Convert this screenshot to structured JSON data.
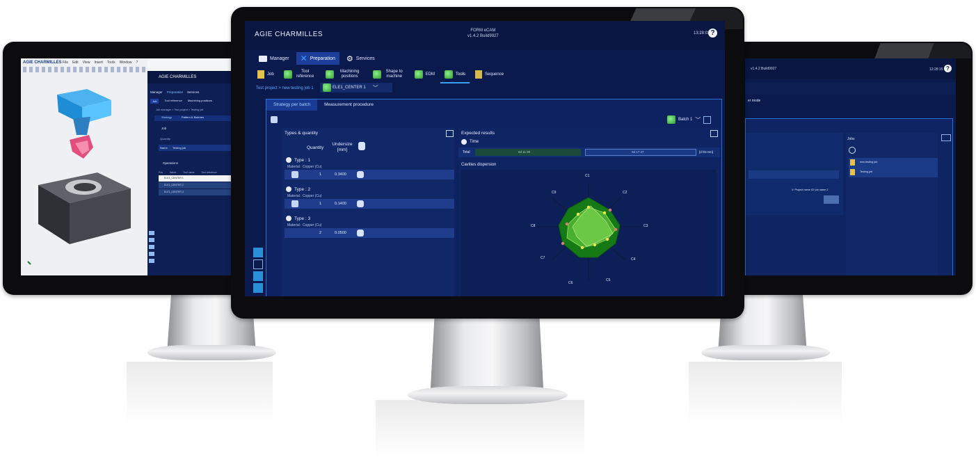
{
  "center": {
    "brand": "AGIE CHARMILLES",
    "app_name": "FORM eCAM",
    "app_version": "v1.4.2 Build9927",
    "clock": "13:28:03",
    "help": "?",
    "main_tabs": [
      "Manager",
      "Preparation",
      "Services"
    ],
    "sub_tabs": [
      "Job",
      "Tool reference",
      "Machining positions",
      "Shape to machine",
      "EDM",
      "Tools",
      "Sequence"
    ],
    "breadcrumb": "Test project > new testing job 1",
    "selector_value": "ELE1_CENTER 1",
    "panel_tabs": [
      "Strategy per batch",
      "Measurement procedure"
    ],
    "batch_label": "Batch 1",
    "types_header": "Types & quantity",
    "quantity_header": "Quantity",
    "undersize_header": "Undersize [mm]",
    "types": [
      {
        "name": "Type : 1",
        "material": "Material : Copper (Cu)",
        "quantity": "1",
        "undersize": "0.3400"
      },
      {
        "name": "Type : 2",
        "material": "Material : Copper (Cu)",
        "quantity": "1",
        "undersize": "0.1400"
      },
      {
        "name": "Type : 3",
        "material": "Material : Copper (Cu)",
        "quantity": "2",
        "undersize": "0.0500"
      }
    ],
    "expected_header": "Expected results",
    "time_label": "Time",
    "total_label": "Total",
    "total_value_1": "0d 11:30",
    "total_value_2": "0d 17:47",
    "time_unit": "[d hh:mm]",
    "cavities_label": "Cavities dispersion",
    "radar_labels": [
      "C1",
      "C2",
      "C3",
      "C4",
      "C5",
      "C6",
      "C7",
      "C8",
      "C9"
    ]
  },
  "left": {
    "brand": "AGIE CHARMILLES",
    "menu": [
      "File",
      "Edit",
      "View",
      "Insert",
      "Tools",
      "Window",
      "?"
    ],
    "panel_brand": "AGIE CHARMILLES",
    "tabs": [
      "Manager",
      "Preparation",
      "Services"
    ],
    "sub_tabs": [
      "Job",
      "Tool reference",
      "Machining positions"
    ],
    "breadcrumb": "Job manager > Test project > Testing job",
    "strategy_tabs": [
      "Strategy",
      "Pattern & Batches"
    ],
    "job_label": "Job",
    "quantity_label": "Quantity",
    "name_label": "Name",
    "name_value": "Testing job",
    "operations_label": "Operations",
    "table_headers": [
      "Pos",
      "Name",
      "Tool name",
      "Tool reference"
    ],
    "rows": [
      "ELE1_CENTER 1",
      "ELE1_CENTER 2",
      "ELE1_CENTER 3"
    ]
  },
  "right": {
    "version": "v1.4.2 Build9927",
    "clock": "13:28:15",
    "help": "?",
    "mode_label": "er mode",
    "jobs_header": "Jobs",
    "jobs": [
      "new testing job",
      "Testing job"
    ],
    "project_name": "V: Project name 02 (ob name 2",
    "colors": {
      "bg": "#0b1a4d",
      "accent": "#2b6fd1"
    }
  },
  "colors": {
    "screen_bg": "#0b1a4d",
    "accent": "#2b6fd1",
    "green": "#3fbf3f",
    "highlight": "#5fa9ff"
  }
}
